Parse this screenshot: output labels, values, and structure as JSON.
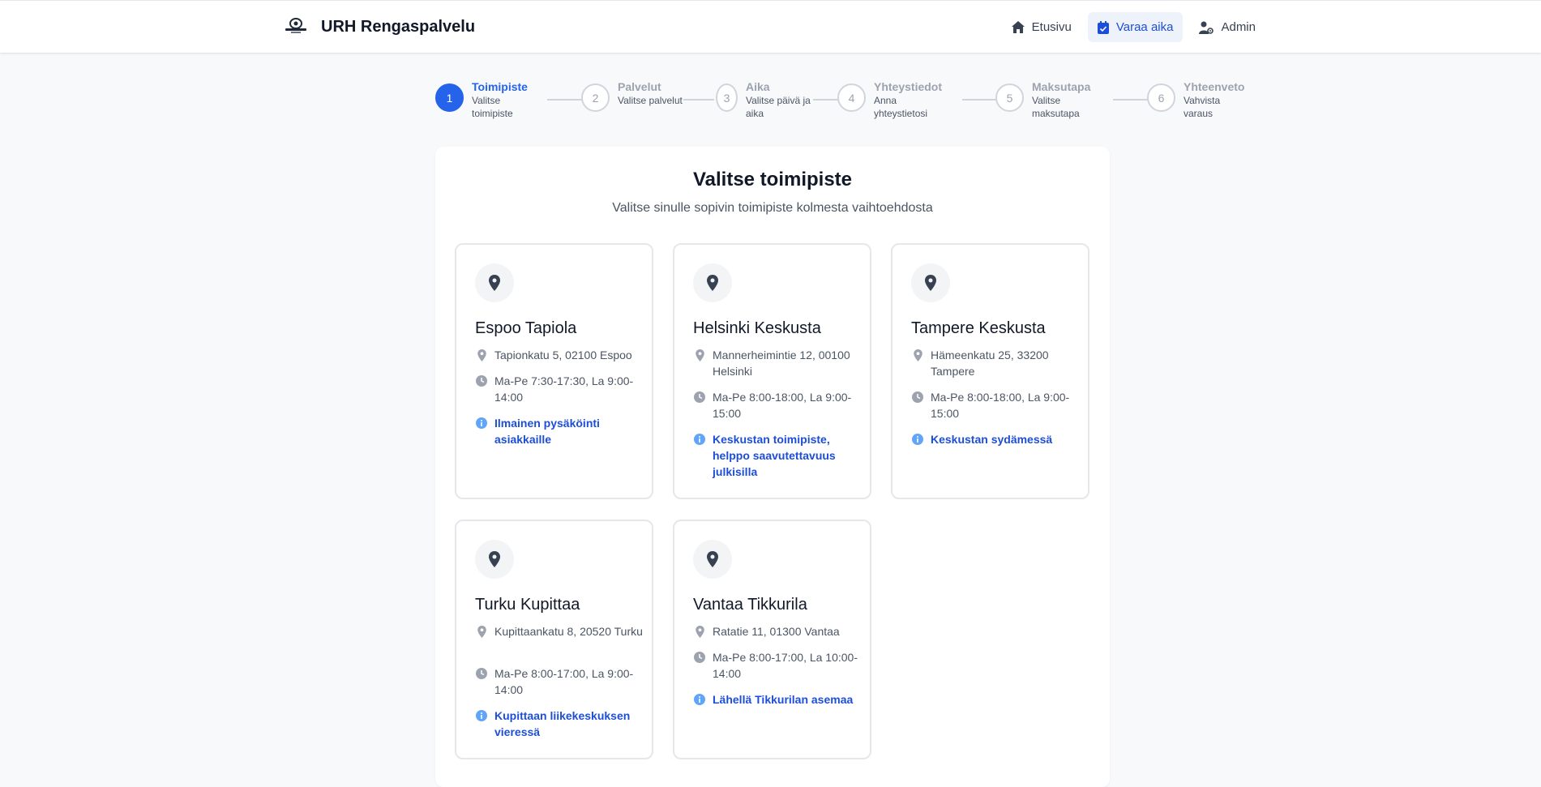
{
  "app": {
    "title": "URH Rengaspalvelu"
  },
  "nav": {
    "items": [
      {
        "label": "Etusivu",
        "icon": "home-icon"
      },
      {
        "label": "Varaa aika",
        "icon": "calendar-check-icon",
        "active": true
      },
      {
        "label": "Admin",
        "icon": "user-cog-icon"
      }
    ]
  },
  "stepper": {
    "steps": [
      {
        "number": "1",
        "title": "Toimipiste",
        "desc": "Valitse toimipiste",
        "active": true
      },
      {
        "number": "2",
        "title": "Palvelut",
        "desc": "Valitse palvelut"
      },
      {
        "number": "3",
        "title": "Aika",
        "desc": "Valitse päivä ja aika"
      },
      {
        "number": "4",
        "title": "Yhteystiedot",
        "desc": "Anna yhteystietosi"
      },
      {
        "number": "5",
        "title": "Maksutapa",
        "desc": "Valitse maksutapa"
      },
      {
        "number": "6",
        "title": "Yhteenveto",
        "desc": "Vahvista varaus"
      }
    ]
  },
  "main": {
    "title": "Valitse toimipiste",
    "subtitle": "Valitse sinulle sopivin toimipiste kolmesta vaihtoehdosta",
    "locations": [
      {
        "name": "Espoo Tapiola",
        "address": "Tapionkatu 5, 02100 Espoo",
        "hours": "Ma-Pe 7:30-17:30, La 9:00-14:00",
        "note": "Ilmainen pysäköinti asiakkaille"
      },
      {
        "name": "Helsinki Keskusta",
        "address": "Mannerheimintie 12, 00100 Helsinki",
        "hours": "Ma-Pe 8:00-18:00, La 9:00-15:00",
        "note": "Keskustan toimipiste, helppo saavutettavuus julkisilla"
      },
      {
        "name": "Tampere Keskusta",
        "address": "Hämeenkatu 25, 33200 Tampere",
        "hours": "Ma-Pe 8:00-18:00, La 9:00-15:00",
        "note": "Keskustan sydämessä"
      },
      {
        "name": "Turku Kupittaa",
        "address": "Kupittaankatu 8, 20520 Turku",
        "hours": "Ma-Pe 8:00-17:00, La 9:00-14:00",
        "note": "Kupittaan liikekeskuksen vieressä"
      },
      {
        "name": "Vantaa Tikkurila",
        "address": "Ratatie 11, 01300 Vantaa",
        "hours": "Ma-Pe 8:00-17:00, La 10:00-14:00",
        "note": "Lähellä Tikkurilan asemaa"
      }
    ]
  },
  "colors": {
    "accent": "#2563eb",
    "note_text": "#1d4ed8",
    "active_nav_bg": "#eef2fb"
  }
}
